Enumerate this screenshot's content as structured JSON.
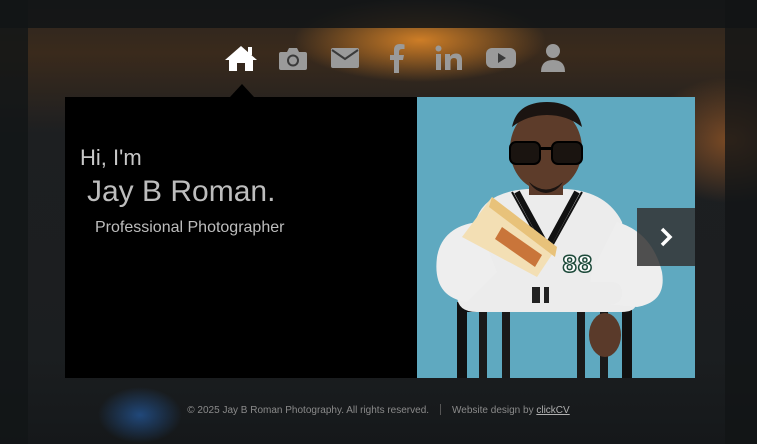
{
  "nav": {
    "items": [
      {
        "icon": "home-icon"
      },
      {
        "icon": "camera-icon"
      },
      {
        "icon": "envelope-icon"
      },
      {
        "icon": "facebook-icon"
      },
      {
        "icon": "linkedin-icon"
      },
      {
        "icon": "youtube-icon"
      },
      {
        "icon": "user-icon"
      }
    ]
  },
  "hero": {
    "greeting": "Hi, I'm",
    "name": "Jay B Roman.",
    "role": "Professional Photographer"
  },
  "footer": {
    "copyright": "© 2025 Jay B Roman Photography. All rights reserved.",
    "credit_prefix": "Website design by ",
    "credit_link": "clickCV"
  },
  "colors": {
    "nav_active": "#ffffff",
    "nav_inactive": "#9a9a9a",
    "panel": "#000000",
    "photo_bg": "#5fa9c0"
  }
}
